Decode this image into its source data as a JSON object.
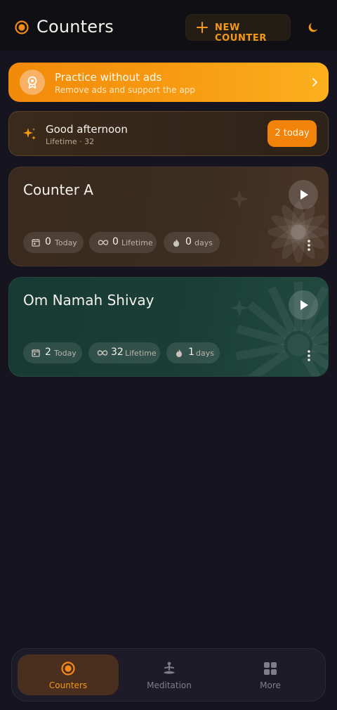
{
  "header": {
    "title": "Counters",
    "new_counter_label": "NEW COUNTER",
    "icons": {
      "logo": "target-icon",
      "add": "plus-icon",
      "theme": "moon-icon"
    }
  },
  "promo": {
    "title": "Practice without ads",
    "subtitle": "Remove ads and support the app"
  },
  "greeting": {
    "title": "Good afternoon",
    "subtitle": "Lifetime · 32",
    "today_badge": "2 today"
  },
  "counters": [
    {
      "name": "Counter A",
      "today": "0",
      "today_label": "Today",
      "lifetime": "0",
      "lifetime_label": "Lifetime",
      "streak": "0",
      "streak_label": "days",
      "theme": "brown"
    },
    {
      "name": "Om Namah Shivay",
      "today": "2",
      "today_label": "Today",
      "lifetime": "32",
      "lifetime_label": "Lifetime",
      "streak": "1",
      "streak_label": "days",
      "theme": "green"
    }
  ],
  "nav": {
    "items": [
      {
        "label": "Counters",
        "icon": "target-icon",
        "active": true
      },
      {
        "label": "Meditation",
        "icon": "meditation-icon",
        "active": false
      },
      {
        "label": "More",
        "icon": "grid-icon",
        "active": false
      }
    ]
  },
  "colors": {
    "accent": "#f59a16",
    "background": "#16151f",
    "brown_card": "#3a2a1e",
    "green_card": "#173a33"
  }
}
